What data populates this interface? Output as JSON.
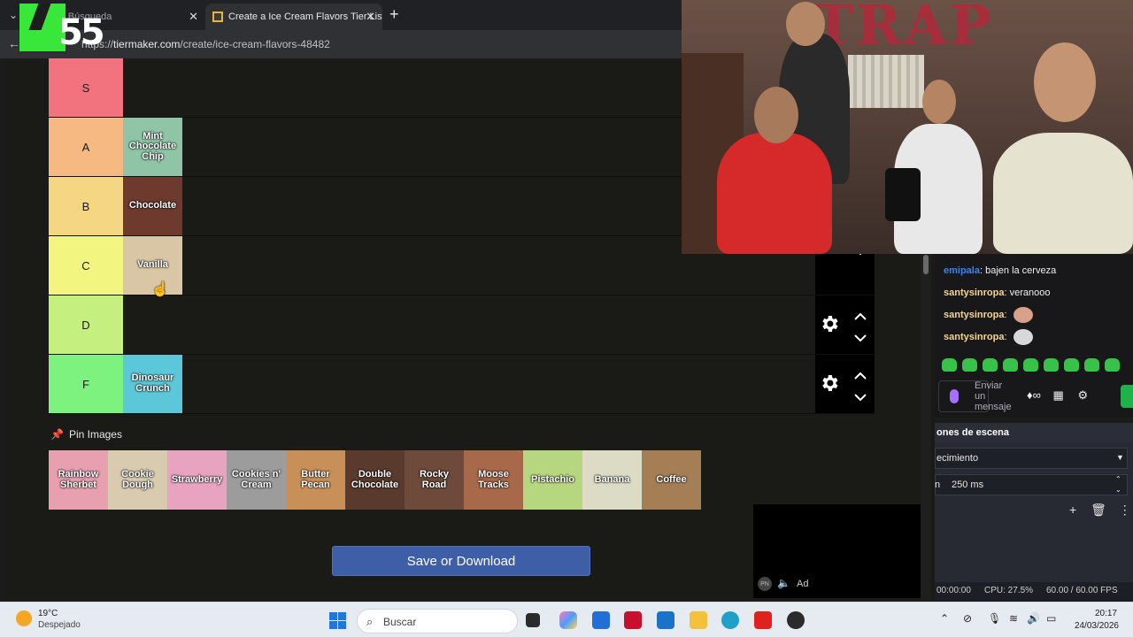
{
  "browser": {
    "tabs": [
      {
        "label": "e pr...s - Búsqueda",
        "active": false
      },
      {
        "label": "Create a Ice Cream Flavors Tier List",
        "active": true
      }
    ],
    "url_prefix": "https://",
    "url_host": "tiermaker.com",
    "url_path": "/create/ice-cream-flavors-48482"
  },
  "overlay_logo": "55",
  "tiers": [
    {
      "label": "S",
      "color": "#f2727e",
      "items": []
    },
    {
      "label": "A",
      "color": "#f5b981",
      "items": [
        {
          "name": "Mint Chocolate Chip",
          "color": "#8fc4a6"
        }
      ]
    },
    {
      "label": "B",
      "color": "#f4d683",
      "items": [
        {
          "name": "Chocolate",
          "color": "#6e3a2e"
        }
      ]
    },
    {
      "label": "C",
      "color": "#f2f57f",
      "items": [
        {
          "name": "Vanilla",
          "color": "#d9c6a5"
        }
      ]
    },
    {
      "label": "D",
      "color": "#c5ef7f",
      "items": []
    },
    {
      "label": "F",
      "color": "#7ef27e",
      "items": [
        {
          "name": "Dinosaur Crunch",
          "color": "#5bc7d8"
        }
      ]
    }
  ],
  "pin_images_label": "Pin Images",
  "pool": [
    {
      "name": "Rainbow Sherbet",
      "color": "#e8a0b0"
    },
    {
      "name": "Cookie Dough",
      "color": "#d8cbb0"
    },
    {
      "name": "Strawberry",
      "color": "#e8a3c0"
    },
    {
      "name": "Cookies n' Cream",
      "color": "#9c9c9c"
    },
    {
      "name": "Butter Pecan",
      "color": "#c98f58"
    },
    {
      "name": "Double Chocolate",
      "color": "#5a3a2c"
    },
    {
      "name": "Rocky Road",
      "color": "#6d4a3a"
    },
    {
      "name": "Moose Tracks",
      "color": "#a8684a"
    },
    {
      "name": "Pistachio",
      "color": "#b7d680"
    },
    {
      "name": "Banana",
      "color": "#dcdcc6"
    },
    {
      "name": "Coffee",
      "color": "#a67e56"
    }
  ],
  "save_button": "Save or Download",
  "ad": {
    "badge": "PN",
    "label": "Ad"
  },
  "webcam": {
    "wall_text": "TRAP"
  },
  "chat": {
    "messages": [
      {
        "user": "emipala",
        "text": "bajen la cerveza",
        "user_color": "#3b82f6"
      },
      {
        "user": "santysinropa",
        "text": "veranooo",
        "user_color": "#f6d58f"
      },
      {
        "user": "santysinropa",
        "text": "",
        "emote": "face-emote",
        "user_color": "#f6d58f"
      },
      {
        "user": "santysinropa",
        "text": "",
        "emote": "ghost-emote",
        "user_color": "#f6d58f"
      }
    ],
    "input_placeholder": "Enviar un mensaje"
  },
  "obs": {
    "panel_title": "ones de escena",
    "transition_value": "ecimiento",
    "duration_value": "250 ms",
    "status_time": "00:00:00",
    "cpu": "CPU: 27.5%",
    "fps": "60.00 / 60.00 FPS"
  },
  "taskbar": {
    "temperature": "19°C",
    "weather": "Despejado",
    "search_placeholder": "Buscar",
    "time": "20:17",
    "date": "24/03/2026"
  }
}
